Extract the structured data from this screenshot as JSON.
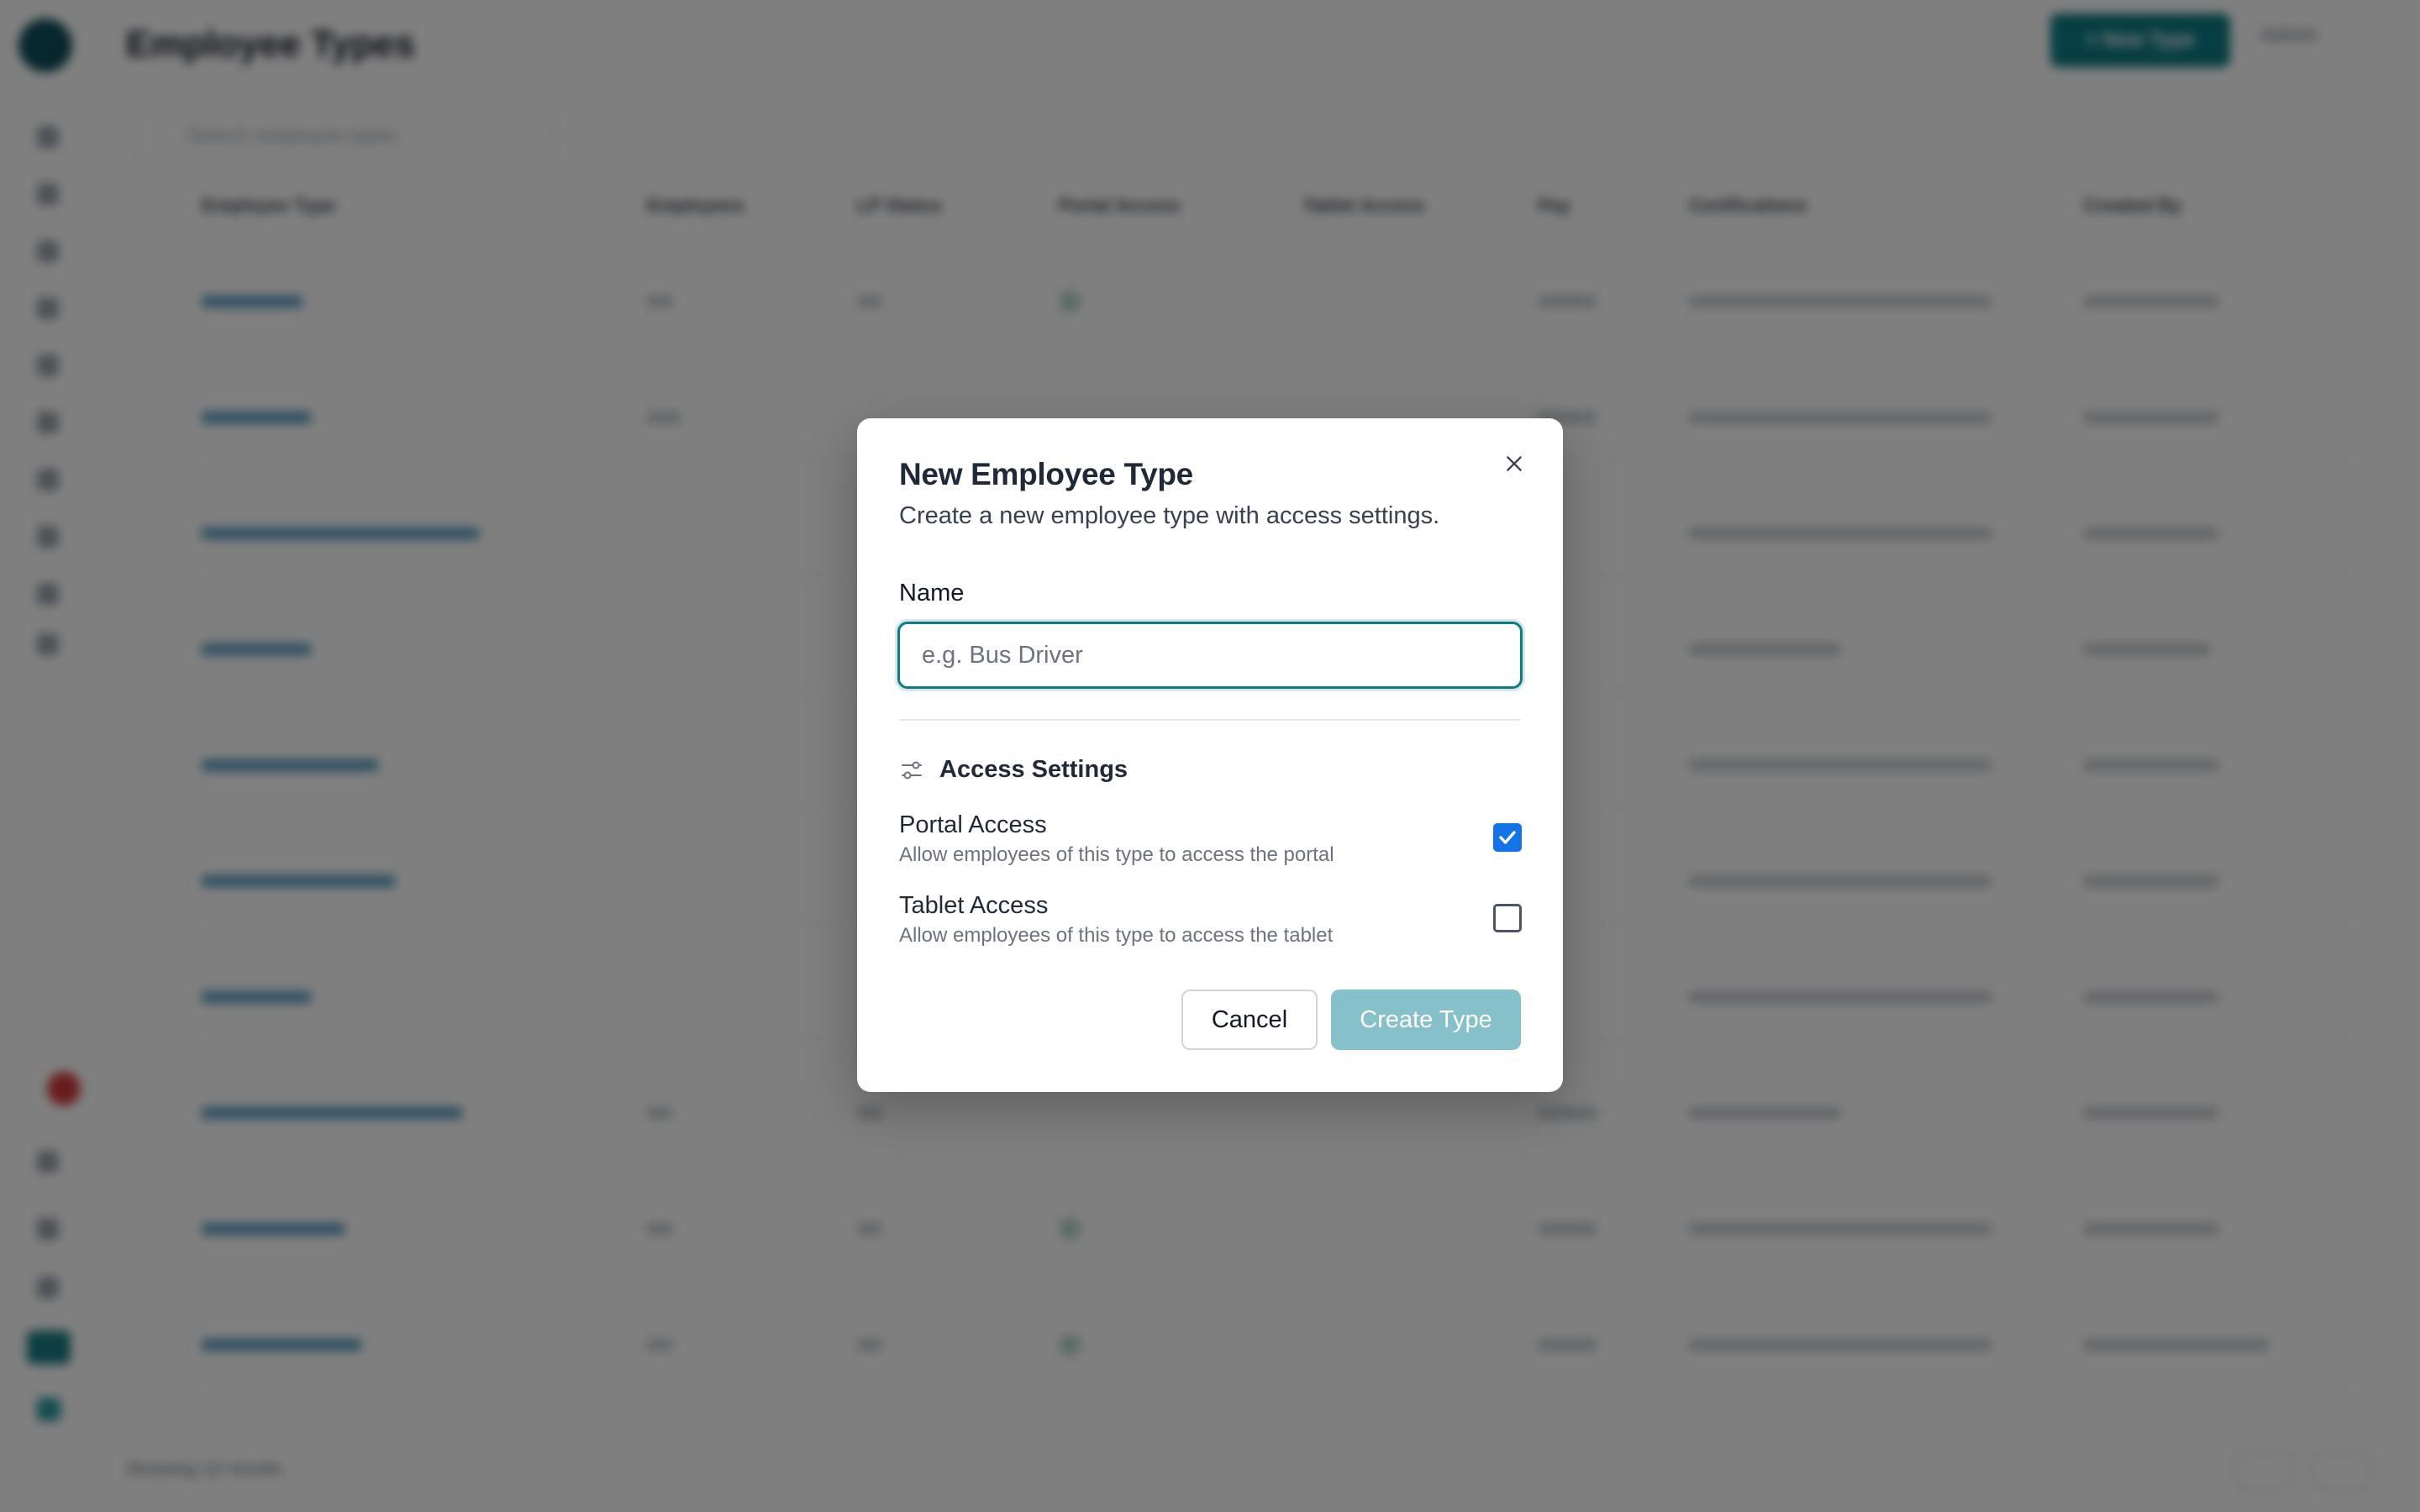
{
  "background": {
    "app_title": "Employee Types",
    "new_button_label": "+ New Type",
    "user_menu_label": "Admin",
    "search_placeholder": "Search employee types",
    "footer_text": "Showing 10 results",
    "table_headers": [
      "Employee Type",
      "Employees",
      "LP Status",
      "Portal Access",
      "Tablet Access",
      "Pay",
      "Certifications",
      "Created By"
    ]
  },
  "dialog": {
    "title": "New Employee Type",
    "description": "Create a new employee type with access settings.",
    "name_field": {
      "label": "Name",
      "placeholder": "e.g. Bus Driver",
      "value": ""
    },
    "section_title": "Access Settings",
    "section_icon": "sliders-icon",
    "options": [
      {
        "title": "Portal Access",
        "description": "Allow employees of this type to access the portal",
        "checked": true
      },
      {
        "title": "Tablet Access",
        "description": "Allow employees of this type to access the tablet",
        "checked": false
      }
    ],
    "cancel_label": "Cancel",
    "create_label": "Create Type"
  },
  "colors": {
    "accent": "#0e7c86",
    "checkbox_checked": "#1473e6",
    "create_button_disabled": "#86c1cb",
    "overlay": "rgba(0,0,0,0.5)"
  }
}
